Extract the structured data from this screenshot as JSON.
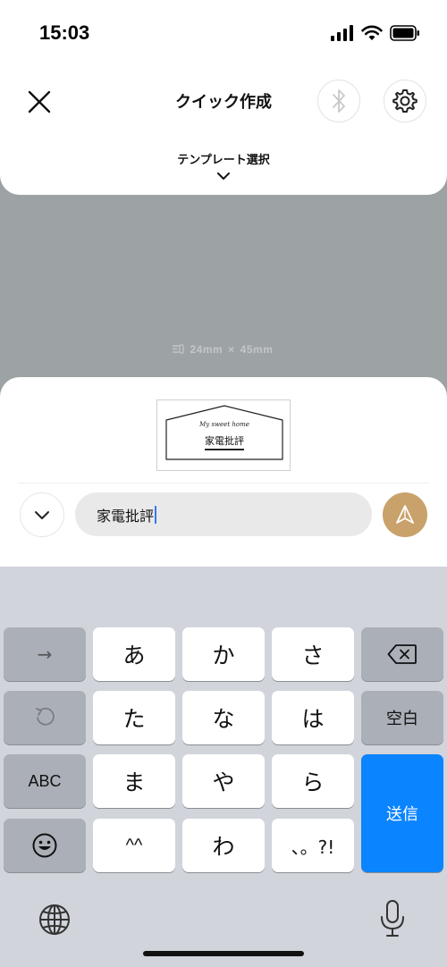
{
  "status_bar": {
    "time": "15:03"
  },
  "header": {
    "title": "クイック作成",
    "template_label": "テンプレート選択"
  },
  "canvas": {
    "width_label": "24mm",
    "times": "×",
    "height_label": "45mm"
  },
  "preview": {
    "script_line": "My sweet home",
    "main_text": "家電批評"
  },
  "editor": {
    "input_value": "家電批評"
  },
  "keyboard": {
    "row1": [
      "→",
      "あ",
      "か",
      "さ"
    ],
    "row2": [
      "た",
      "な",
      "は",
      "空白"
    ],
    "row3": [
      "ABC",
      "ま",
      "や",
      "ら"
    ],
    "row4": [
      "^^",
      "わ",
      "、。?!"
    ],
    "send_label": "送信"
  },
  "colors": {
    "send_button": "#c8a26a",
    "keyboard_send": "#0a84ff",
    "canvas_bg": "#9da2a5"
  }
}
